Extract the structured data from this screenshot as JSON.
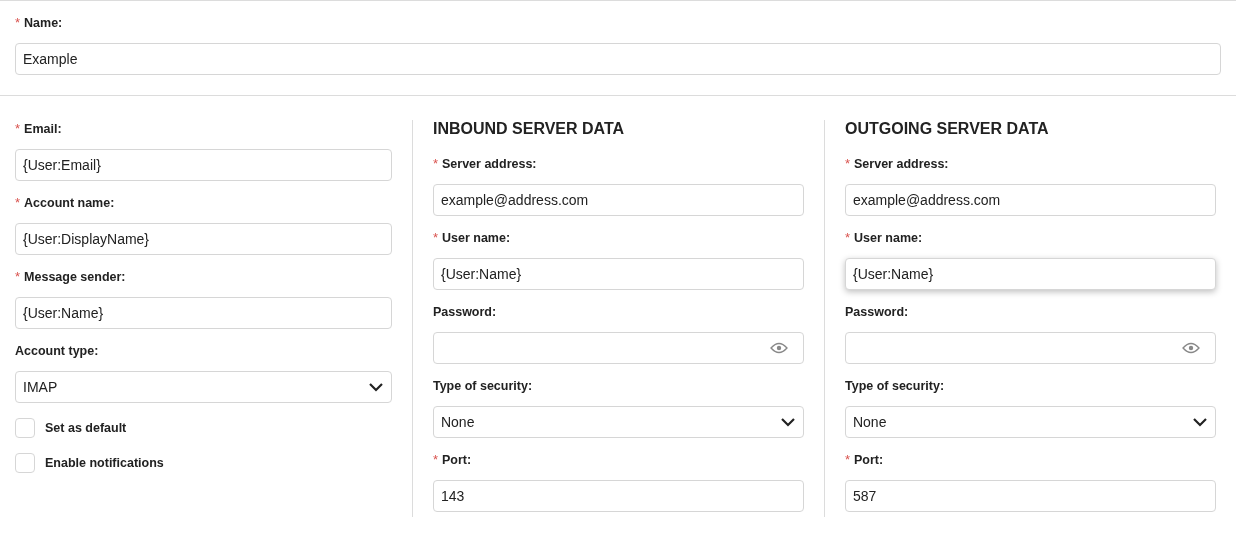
{
  "name_field": {
    "label": "Name:",
    "asterisk": "*",
    "value": "Example",
    "focused": false
  },
  "columns": [
    {
      "fields": [
        {
          "kind": "text",
          "label": "Email:",
          "asterisk": "*",
          "value": "{User:Email}",
          "focused": false
        },
        {
          "kind": "text",
          "label": "Account name:",
          "asterisk": "*",
          "value": "{User:DisplayName}",
          "focused": false
        },
        {
          "kind": "text",
          "label": "Message sender:",
          "asterisk": "*",
          "value": "{User:Name}",
          "focused": false
        },
        {
          "kind": "select",
          "label": "Account type:",
          "value": "IMAP",
          "focused": false
        },
        {
          "kind": "checkbox",
          "label": "Set as default",
          "checked": false
        },
        {
          "kind": "checkbox",
          "label": "Enable notifications",
          "checked": false
        }
      ]
    },
    {
      "heading": "INBOUND SERVER DATA",
      "fields": [
        {
          "kind": "text",
          "label": "Server address:",
          "asterisk": "*",
          "value": "example@address.com",
          "focused": false
        },
        {
          "kind": "text",
          "label": "User name:",
          "asterisk": "*",
          "value": "{User:Name}",
          "focused": false
        },
        {
          "kind": "password",
          "label": "Password:",
          "focused": false
        },
        {
          "kind": "select",
          "label": "Type of security:",
          "value": "None",
          "focused": false
        },
        {
          "kind": "text",
          "label": "Port:",
          "asterisk": "*",
          "value": "143",
          "focused": false
        }
      ]
    },
    {
      "heading": "OUTGOING SERVER DATA",
      "fields": [
        {
          "kind": "text",
          "label": "Server address:",
          "asterisk": "*",
          "value": "example@address.com",
          "focused": false
        },
        {
          "kind": "text",
          "label": "User name:",
          "asterisk": "*",
          "value": "{User:Name}",
          "focused": true
        },
        {
          "kind": "password",
          "label": "Password:",
          "focused": false
        },
        {
          "kind": "select",
          "label": "Type of security:",
          "value": "None",
          "focused": false
        },
        {
          "kind": "text",
          "label": "Port:",
          "asterisk": "*",
          "value": "587",
          "focused": false
        }
      ]
    }
  ]
}
